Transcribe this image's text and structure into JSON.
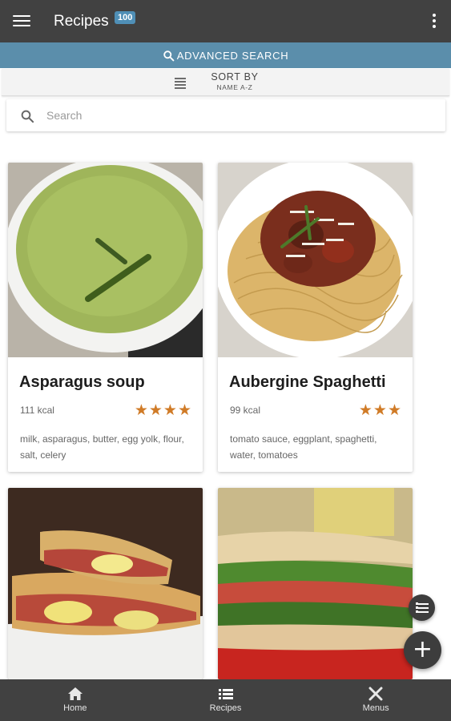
{
  "appbar": {
    "title": "Recipes",
    "badge": "100"
  },
  "advanced_search": {
    "label": "ADVANCED SEARCH"
  },
  "sort": {
    "label": "SORT BY",
    "value": "NAME A-Z"
  },
  "search": {
    "placeholder": "Search"
  },
  "recipes": [
    {
      "name": "Asparagus soup",
      "kcal": "111 kcal",
      "stars": "★★★★",
      "rating": 4,
      "ingredients": "milk, asparagus, butter, egg yolk, flour, salt, celery"
    },
    {
      "name": "Aubergine Spaghetti",
      "kcal": "99 kcal",
      "stars": "★★★",
      "rating": 3,
      "ingredients": "tomato sauce, eggplant, spaghetti, water, tomatoes"
    },
    {
      "name": "",
      "kcal": "",
      "stars": "",
      "ingredients": ""
    },
    {
      "name": "",
      "kcal": "",
      "stars": "",
      "ingredients": ""
    }
  ],
  "fab": {
    "add_symbol": "+"
  },
  "bottom_nav": [
    {
      "label": "Home",
      "icon": "home-icon"
    },
    {
      "label": "Recipes",
      "icon": "list-icon"
    },
    {
      "label": "Menus",
      "icon": "utensils-icon"
    }
  ],
  "colors": {
    "appbar": "#414141",
    "advanced_search_bar": "#5b8eab",
    "badge": "#4f8fb6",
    "star": "#d07b27"
  }
}
